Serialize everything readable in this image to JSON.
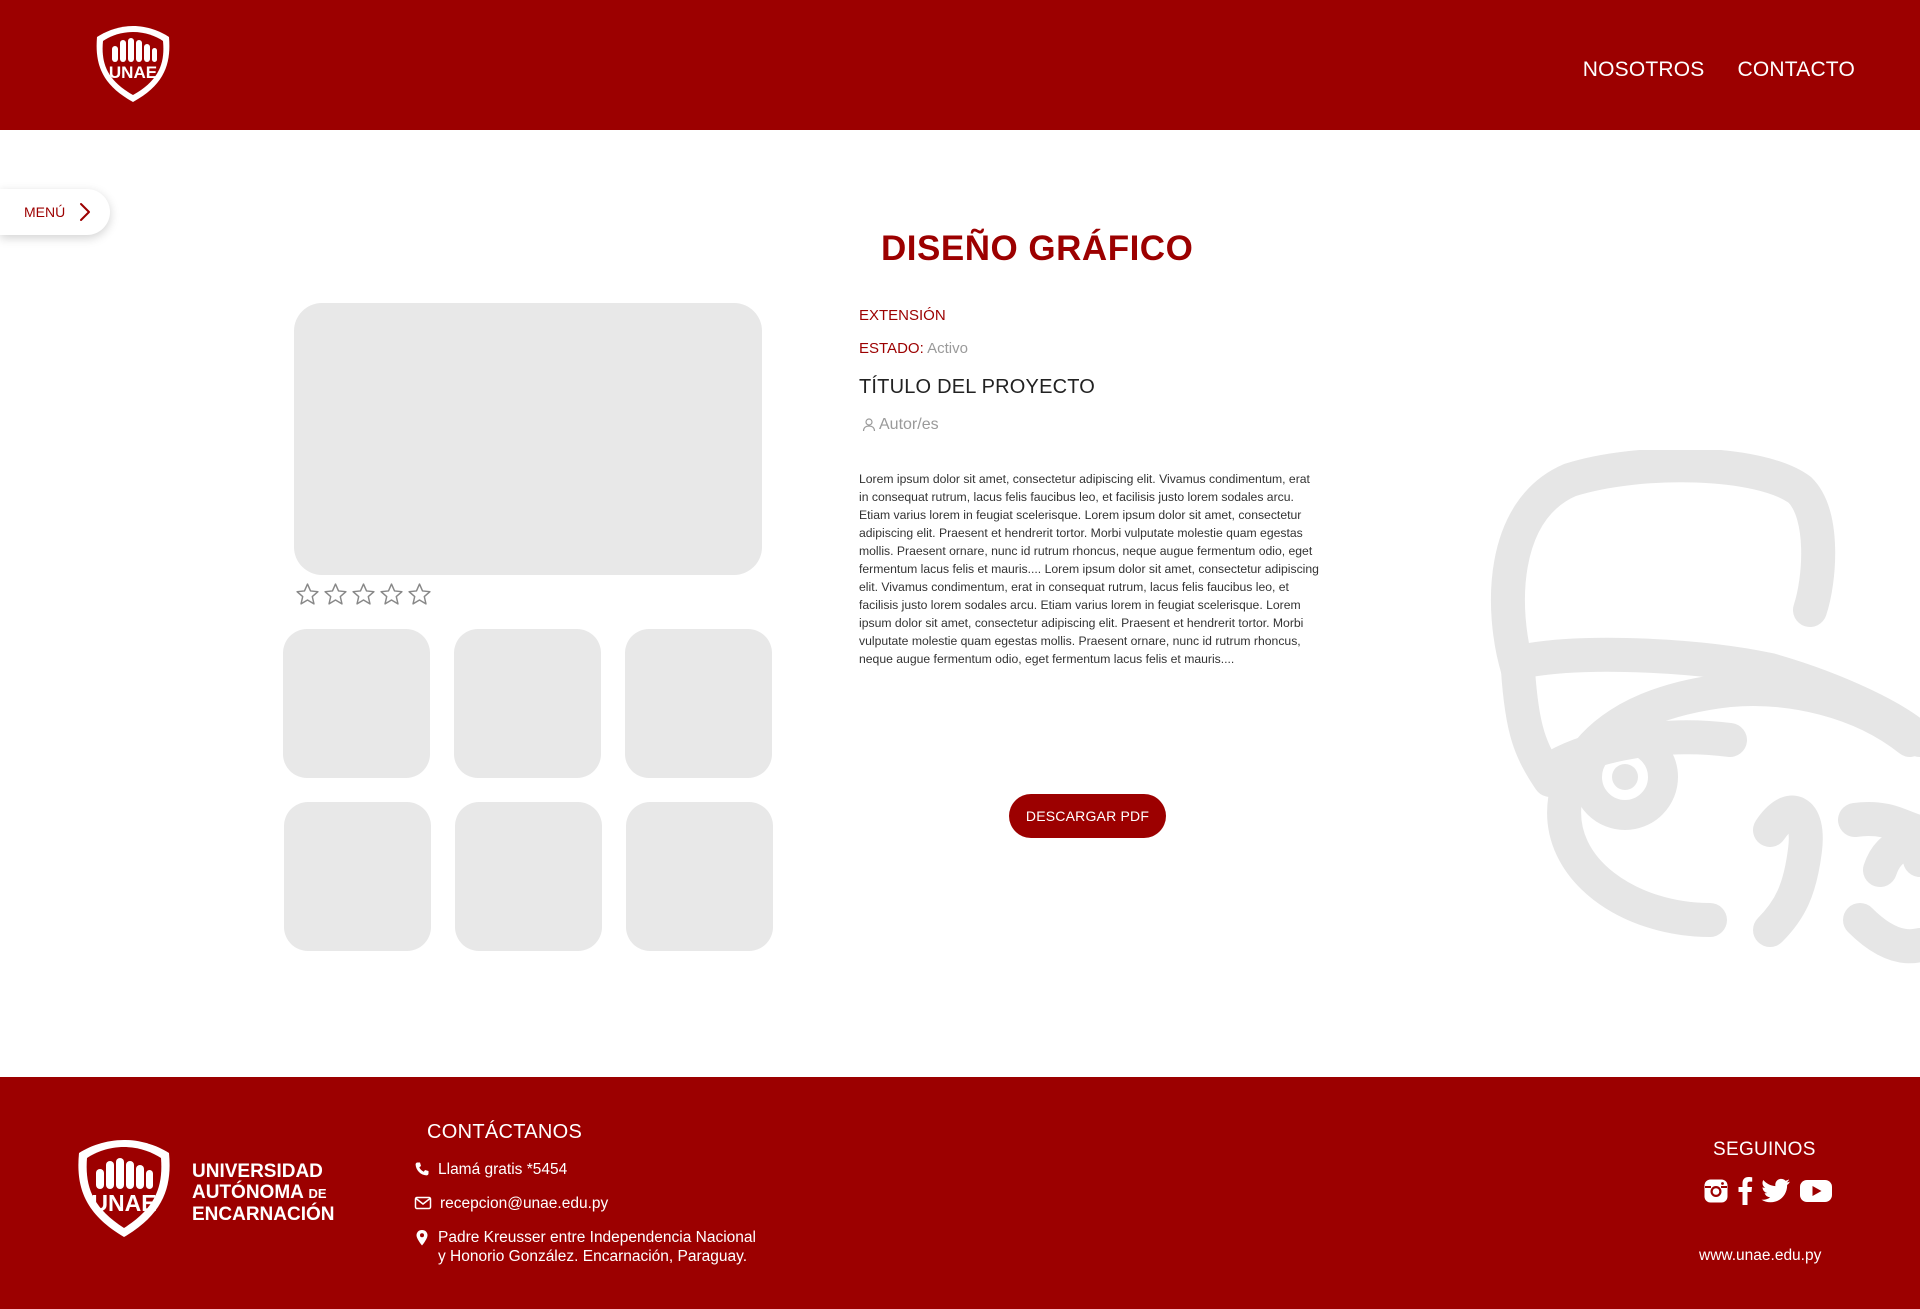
{
  "header": {
    "logo_text": "UNAE",
    "nav": [
      "NOSOTROS",
      "CONTACTO"
    ]
  },
  "menu": {
    "label": "MENÚ"
  },
  "page": {
    "title": "DISEÑO GRÁFICO",
    "extension_label": "EXTENSIÓN",
    "estado_label": "ESTADO:",
    "estado_value": "Activo",
    "project_title": "TÍTULO DEL PROYECTO",
    "authors": "Autor/es",
    "description": "Lorem ipsum dolor sit amet, consectetur adipiscing elit. Vivamus condimentum, erat in consequat rutrum, lacus felis faucibus leo, et facilisis justo lorem sodales arcu. Etiam varius lorem in feugiat scelerisque. Lorem ipsum dolor sit amet, consectetur adipiscing elit. Praesent et hendrerit tortor. Morbi vulputate molestie quam egestas mollis. Praesent ornare, nunc id rutrum rhoncus, neque augue fermentum odio, eget fermentum lacus felis et mauris.... Lorem ipsum dolor sit amet, consectetur adipiscing elit. Vivamus condimentum, erat in consequat rutrum, lacus felis faucibus leo, et facilisis justo lorem sodales arcu. Etiam varius lorem in feugiat scelerisque. Lorem ipsum dolor sit amet, consectetur adipiscing elit. Praesent et hendrerit tortor. Morbi vulputate molestie quam egestas mollis. Praesent ornare, nunc id rutrum rhoncus, neque augue fermentum odio, eget fermentum lacus felis et mauris....",
    "download_button": "DESCARGAR PDF",
    "rating": {
      "value": 0,
      "max": 5
    }
  },
  "footer": {
    "logo_text": "UNAE",
    "university_name_line1": "UNIVERSIDAD",
    "university_name_line2": "AUTÓNOMA",
    "university_name_de": "DE",
    "university_name_line3": "ENCARNACIÓN",
    "contact_title": "CONTÁCTANOS",
    "phone": "Llamá gratis *5454",
    "email": "recepcion@unae.edu.py",
    "address_line1": "Padre Kreusser entre Independencia Nacional",
    "address_line2": "y Honorio González. Encarnación, Paraguay.",
    "follow_title": "SEGUINOS",
    "website": "www.unae.edu.py"
  },
  "colors": {
    "brand": "#9c0000",
    "placeholder": "#e8e8e8"
  },
  "icons": [
    "phone-icon",
    "mail-icon",
    "location-icon",
    "instagram-icon",
    "facebook-icon",
    "twitter-icon",
    "youtube-icon",
    "user-icon",
    "star-icon",
    "chevron-right-icon"
  ]
}
